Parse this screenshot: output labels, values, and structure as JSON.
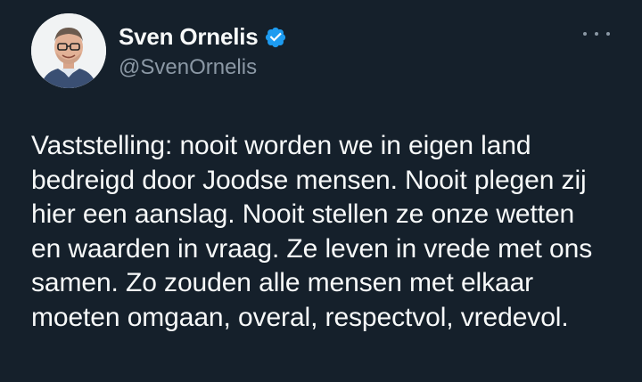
{
  "author": {
    "display_name": "Sven Ornelis",
    "handle": "@SvenOrnelis",
    "verified": true,
    "avatar_icon": "profile-photo",
    "verified_icon": "verified-badge-icon"
  },
  "actions": {
    "more_icon": "more-horizontal-icon"
  },
  "tweet": {
    "text": "Vaststelling: nooit worden we in eigen land\nbedreigd door Joodse mensen. Nooit plegen zij\nhier een aanslag. Nooit stellen ze onze wetten\nen waarden in vraag. Ze leven in vrede met ons\nsamen. Zo zouden alle mensen met elkaar\nmoeten omgaan, overal, respectvol, vredevol."
  },
  "colors": {
    "background": "#15202b",
    "text_primary": "#f7f9f9",
    "text_secondary": "#8b98a5",
    "verified_blue": "#1d9bf0"
  }
}
